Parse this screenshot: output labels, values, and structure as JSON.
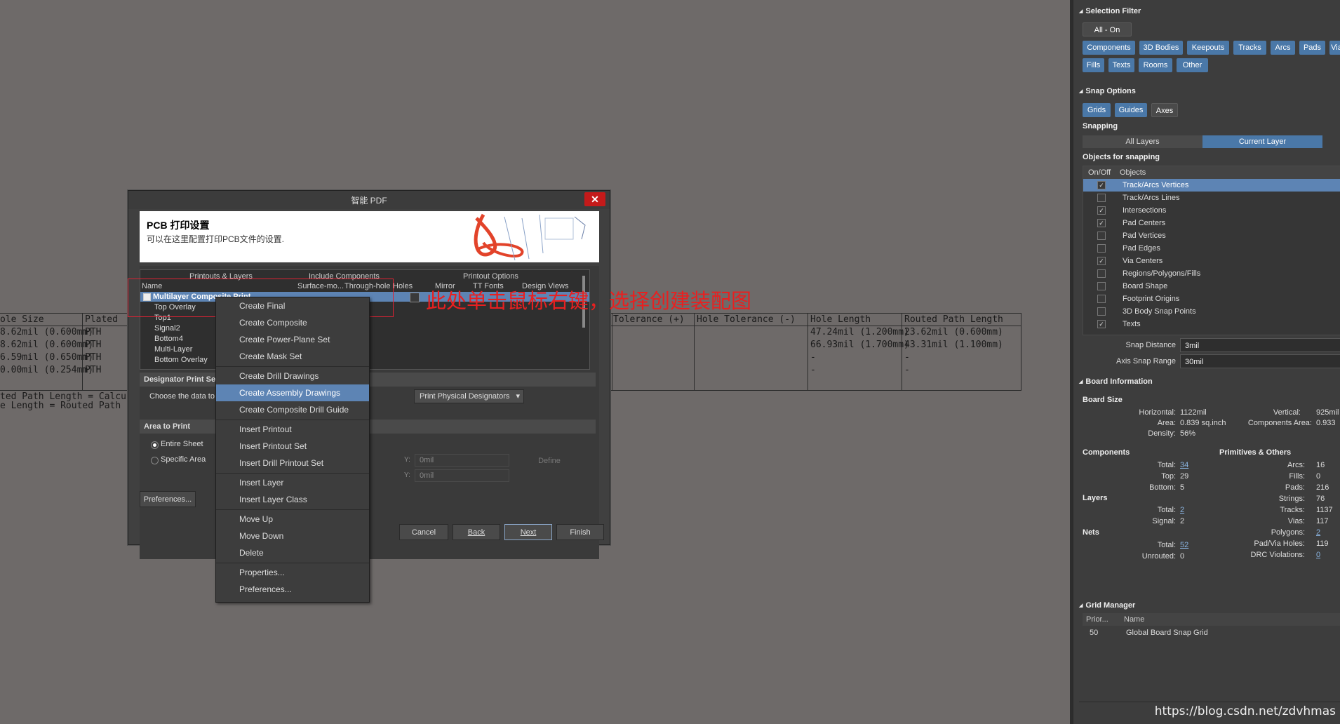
{
  "background_table": {
    "headers": [
      "ole Size",
      "Plated",
      "Tolerance (+)",
      "Hole Tolerance (-)",
      "Hole Length",
      "Routed Path Length"
    ],
    "hole_sizes": [
      "8.62mil (0.600mm)",
      "8.62mil (0.600mm)",
      "6.59mil (0.650mm)",
      "0.00mil (0.254mm)"
    ],
    "plated": [
      "PTH",
      "PTH",
      "PTH",
      "PTH"
    ],
    "hole_lengths": [
      "47.24mil (1.200mm)",
      "66.93mil (1.700mm)",
      "-",
      "-"
    ],
    "routed_lengths": [
      "23.62mil (0.600mm)",
      "43.31mil (1.100mm)",
      "-",
      "-"
    ],
    "footnote1": "ted Path Length = Calculat",
    "footnote2": "e Length  = Routed Path L"
  },
  "dialog": {
    "title": "智能 PDF",
    "close": "✕",
    "header_title": "PCB 打印设置",
    "header_subtitle": "可以在这里配置打印PCB文件的设置.",
    "group_headers": [
      "Printouts & Layers",
      "Include Components",
      "Printout Options"
    ],
    "columns": [
      "Name",
      "Surface-mo...",
      "Through-hole",
      "Holes",
      "Mirror",
      "TT Fonts",
      "Design Views"
    ],
    "tree_root": "Multilayer Composite Print",
    "tree_children": [
      "Top Overlay",
      "Top1",
      "Signal2",
      "Bottom4",
      "Multi-Layer",
      "Bottom Overlay"
    ],
    "designator_section": "Designator Print Setti",
    "choose_label": "Choose the data to",
    "designator_select": "Print Physical Designators",
    "area_section": "Area to Print",
    "radio_entire": "Entire Sheet",
    "radio_specific": "Specific Area",
    "y_label": "Y:",
    "y1": "0mil",
    "y2": "0mil",
    "define": "Define",
    "preferences": "Preferences...",
    "cancel": "Cancel",
    "back": "Back",
    "next": "Next",
    "finish": "Finish"
  },
  "annotation": "此处单击鼠标右键，选择创建装配图",
  "context_menu": [
    "Create Final",
    "Create Composite",
    "Create Power-Plane Set",
    "Create Mask Set",
    "Create Drill Drawings",
    "Create Assembly Drawings",
    "Create Composite Drill Guide",
    "Insert Printout",
    "Insert Printout Set",
    "Insert Drill Printout Set",
    "Insert Layer",
    "Insert Layer Class",
    "Move Up",
    "Move Down",
    "Delete",
    "Properties...",
    "Preferences..."
  ],
  "right_panel": {
    "selection_filter": "Selection Filter",
    "all_on": "All - On",
    "filter_chips": [
      "Components",
      "3D Bodies",
      "Keepouts",
      "Tracks",
      "Arcs",
      "Pads",
      "Via",
      "Fills",
      "Texts",
      "Rooms",
      "Other"
    ],
    "snap_options": "Snap Options",
    "snap_chips": [
      "Grids",
      "Guides",
      "Axes"
    ],
    "snapping": "Snapping",
    "all_layers": "All Layers",
    "current_layer": "Current Layer",
    "objects_for_snapping": "Objects for snapping",
    "obj_headers": [
      "On/Off",
      "Objects"
    ],
    "objects": [
      {
        "name": "Track/Arcs Vertices",
        "on": "✓"
      },
      {
        "name": "Track/Arcs Lines",
        "on": ""
      },
      {
        "name": "Intersections",
        "on": "✓"
      },
      {
        "name": "Pad Centers",
        "on": "✓"
      },
      {
        "name": "Pad Vertices",
        "on": ""
      },
      {
        "name": "Pad Edges",
        "on": ""
      },
      {
        "name": "Via Centers",
        "on": "✓"
      },
      {
        "name": "Regions/Polygons/Fills",
        "on": ""
      },
      {
        "name": "Board Shape",
        "on": ""
      },
      {
        "name": "Footprint Origins",
        "on": ""
      },
      {
        "name": "3D Body Snap Points",
        "on": ""
      },
      {
        "name": "Texts",
        "on": "✓"
      }
    ],
    "snap_distance_label": "Snap Distance",
    "snap_distance": "3mil",
    "axis_snap_label": "Axis Snap Range",
    "axis_snap": "30mil",
    "board_information": "Board Information",
    "board_size": "Board Size",
    "horizontal_label": "Horizontal:",
    "horizontal": "1122mil",
    "vertical_label": "Vertical:",
    "vertical": "925mil",
    "area_label": "Area:",
    "area": "0.839 sq.inch",
    "comp_area_label": "Components Area:",
    "comp_area": "0.933",
    "density_label": "Density:",
    "density": "56%",
    "components": "Components",
    "primitives": "Primitives & Others",
    "total_label": "Total:",
    "comp_total": "34",
    "top_label": "Top:",
    "comp_top": "29",
    "bottom_label": "Bottom:",
    "comp_bottom": "5",
    "layers": "Layers",
    "layers_total": "2",
    "signal_label": "Signal:",
    "layers_signal": "2",
    "nets": "Nets",
    "nets_total": "52",
    "unrouted_label": "Unrouted:",
    "nets_unrouted": "0",
    "arcs_label": "Arcs:",
    "arcs": "16",
    "fills_label": "Fills:",
    "fills": "0",
    "pads_label": "Pads:",
    "pads": "216",
    "strings_label": "Strings:",
    "strings": "76",
    "tracks_label": "Tracks:",
    "tracks": "1137",
    "vias_label": "Vias:",
    "vias": "117",
    "polygons_label": "Polygons:",
    "polygons": "2",
    "padvia_label": "Pad/Via Holes:",
    "padvia": "119",
    "drc_label": "DRC Violations:",
    "drc": "0",
    "grid_manager": "Grid Manager",
    "grid_headers": [
      "Prior...",
      "Name"
    ],
    "grid_priority": "50",
    "grid_name": "Global Board Snap Grid"
  },
  "watermark": "https://blog.csdn.net/zdvhmas"
}
